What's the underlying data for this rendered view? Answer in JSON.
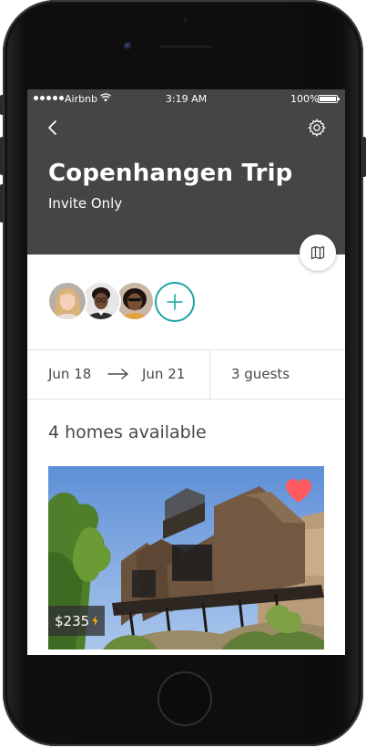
{
  "status_bar": {
    "carrier": "Airbnb",
    "time": "3:19 AM",
    "battery": "100%"
  },
  "header": {
    "title": "Copenhangen Trip",
    "subtitle": "Invite Only"
  },
  "trip": {
    "start_date": "Jun 18",
    "end_date": "Jun 21",
    "guests": "3 guests"
  },
  "homes": {
    "heading": "4 homes available",
    "listings": [
      {
        "price": "$235",
        "favorited": true
      }
    ]
  },
  "colors": {
    "header_bg": "#454545",
    "accent": "#1aa6a0",
    "heart": "#ff5a5f",
    "instant_book": "#ffb400"
  },
  "icons": [
    "back-icon",
    "gear-icon",
    "map-icon",
    "plus-icon",
    "arrow-right-icon",
    "heart-icon",
    "lightning-icon",
    "wifi-icon"
  ]
}
